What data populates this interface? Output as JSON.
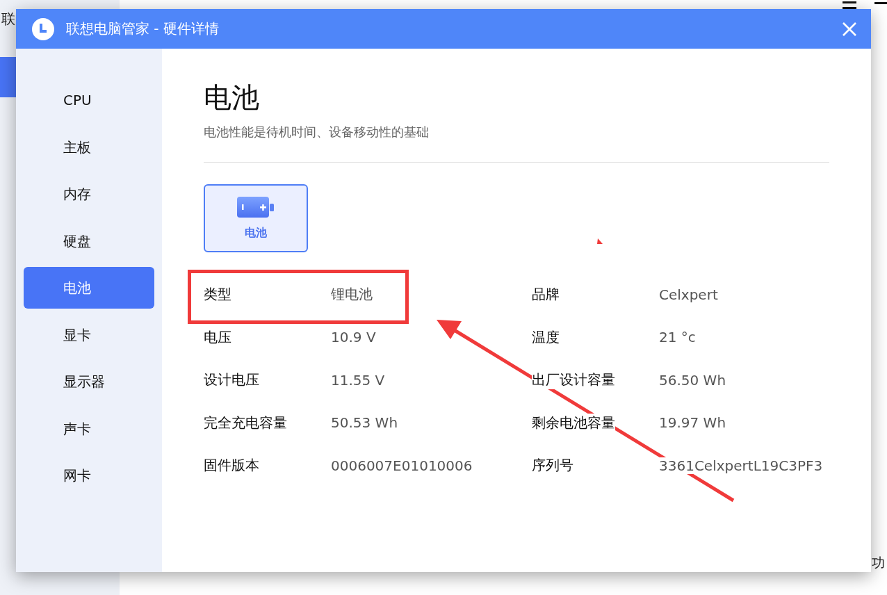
{
  "background_app": {
    "corner_text": "联",
    "bottom_text": "功"
  },
  "window": {
    "title": "联想电脑管家 - 硬件详情"
  },
  "sidebar": {
    "items": [
      {
        "label": "CPU",
        "selected": false
      },
      {
        "label": "主板",
        "selected": false
      },
      {
        "label": "内存",
        "selected": false
      },
      {
        "label": "硬盘",
        "selected": false
      },
      {
        "label": "电池",
        "selected": true
      },
      {
        "label": "显卡",
        "selected": false
      },
      {
        "label": "显示器",
        "selected": false
      },
      {
        "label": "声卡",
        "selected": false
      },
      {
        "label": "网卡",
        "selected": false
      }
    ]
  },
  "content": {
    "heading": "电池",
    "subtitle": "电池性能是待机时间、设备移动性的基础",
    "devices": [
      {
        "label": "电池",
        "selected": true
      }
    ],
    "specs": [
      {
        "label": "类型",
        "value": "锂电池"
      },
      {
        "label": "品牌",
        "value": "Celxpert"
      },
      {
        "label": "电压",
        "value": "10.9 V"
      },
      {
        "label": "温度",
        "value": "21 °c"
      },
      {
        "label": "设计电压",
        "value": "11.55 V"
      },
      {
        "label": "出厂设计容量",
        "value": "56.50 Wh"
      },
      {
        "label": "完全充电容量",
        "value": "50.53 Wh"
      },
      {
        "label": "剩余电池容量",
        "value": "19.97 Wh"
      },
      {
        "label": "固件版本",
        "value": "0006007E01010006"
      },
      {
        "label": "序列号",
        "value": "3361CelxpertL19C3PF3"
      }
    ]
  }
}
